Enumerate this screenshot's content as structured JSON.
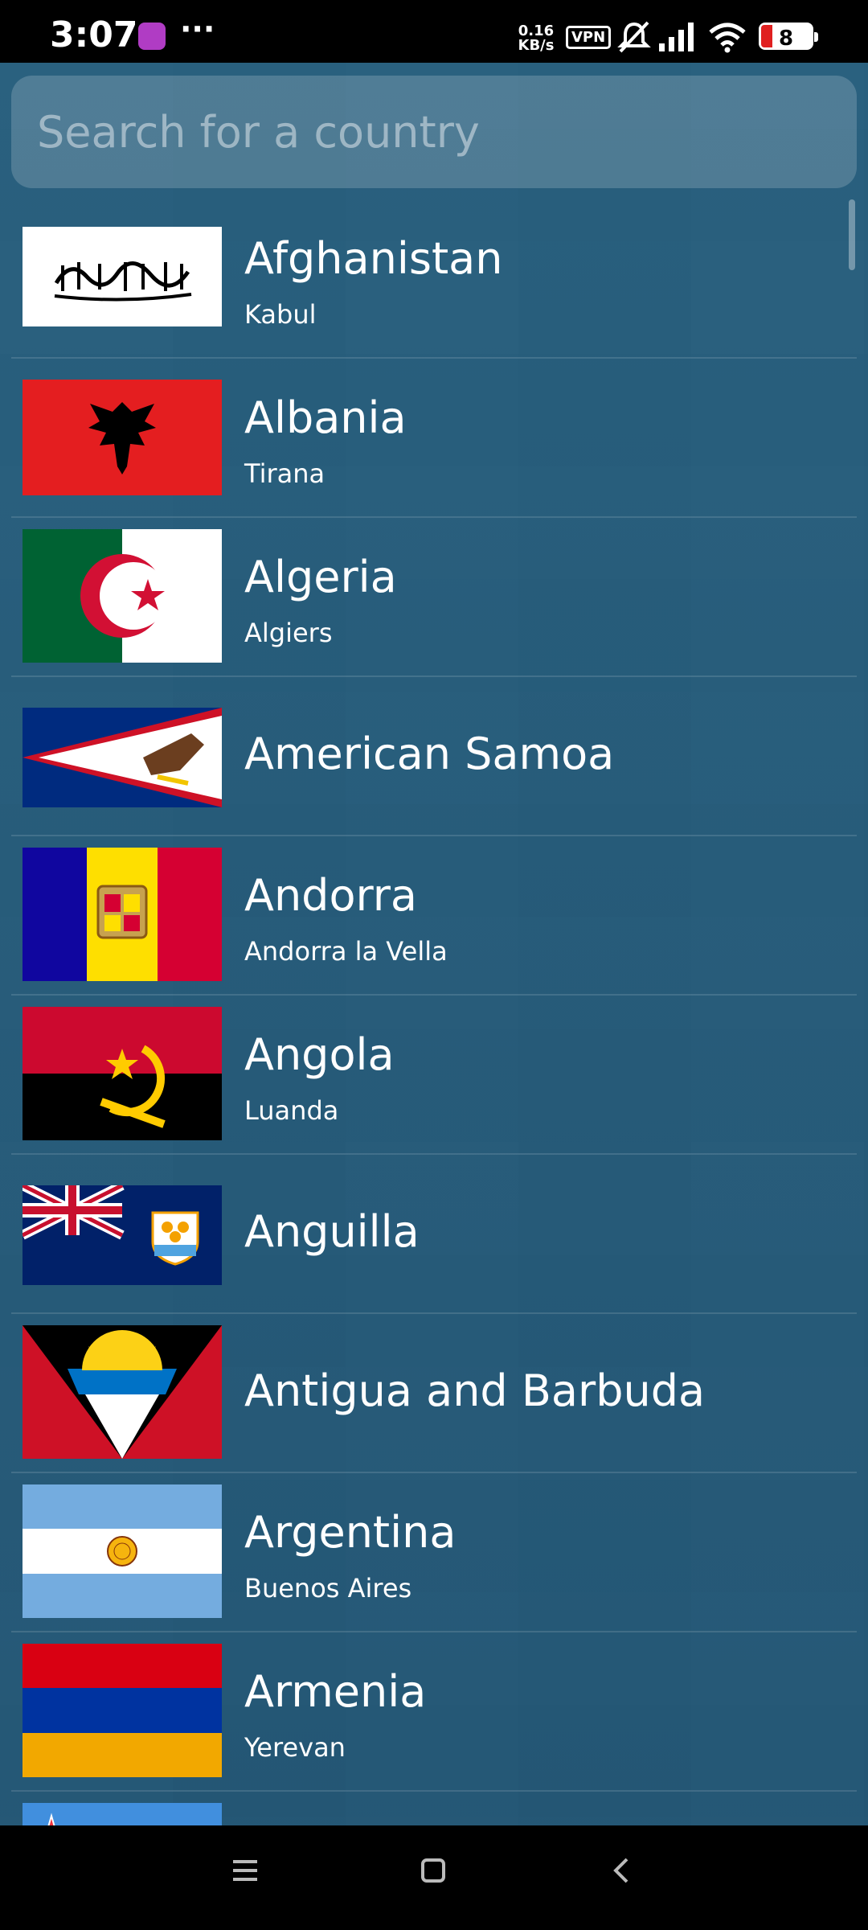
{
  "status_bar": {
    "time": "3:07",
    "dots": "···",
    "net_speed_value": "0.16",
    "net_speed_unit": "KB/s",
    "vpn": "VPN",
    "battery": "8"
  },
  "search": {
    "placeholder": "Search for a country",
    "value": ""
  },
  "countries": [
    {
      "name": "Afghanistan",
      "capital": "Kabul"
    },
    {
      "name": "Albania",
      "capital": "Tirana"
    },
    {
      "name": "Algeria",
      "capital": "Algiers"
    },
    {
      "name": "American Samoa",
      "capital": ""
    },
    {
      "name": "Andorra",
      "capital": "Andorra la Vella"
    },
    {
      "name": "Angola",
      "capital": "Luanda"
    },
    {
      "name": "Anguilla",
      "capital": ""
    },
    {
      "name": "Antigua and Barbuda",
      "capital": ""
    },
    {
      "name": "Argentina",
      "capital": "Buenos Aires"
    },
    {
      "name": "Armenia",
      "capital": "Yerevan"
    }
  ],
  "nav_bar": {
    "icons": [
      "menu-icon",
      "home-icon",
      "back-icon"
    ]
  }
}
